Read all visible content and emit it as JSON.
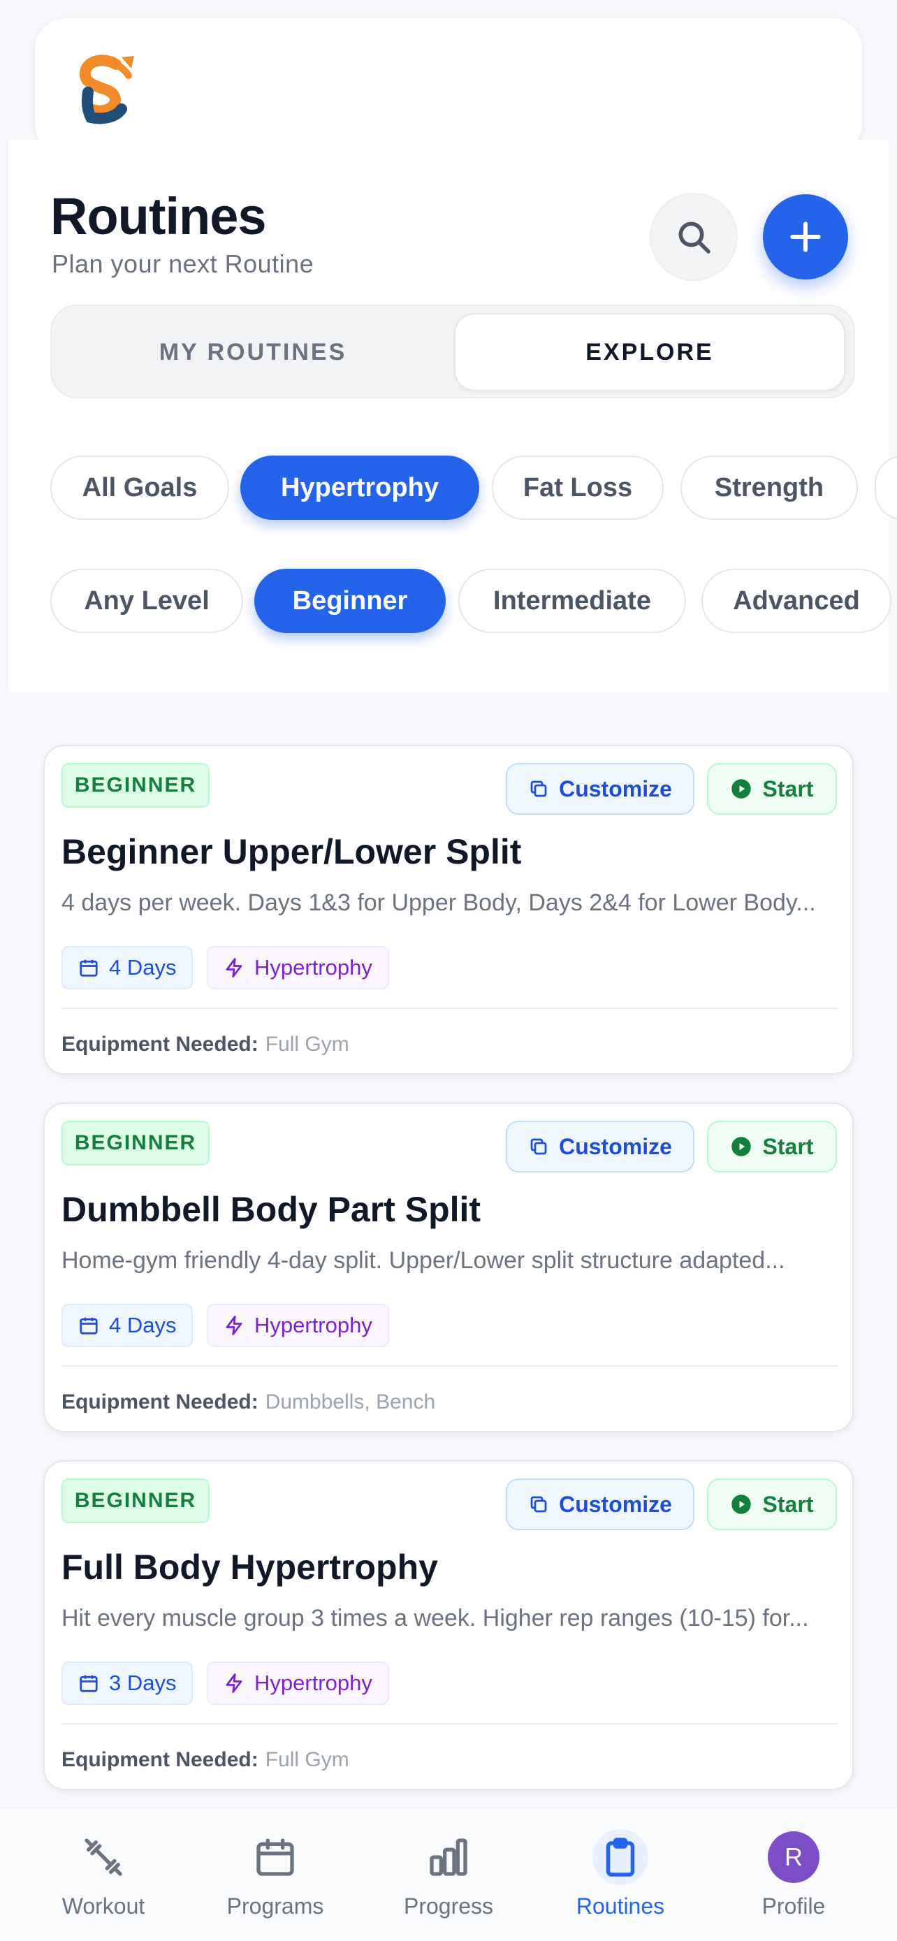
{
  "header": {
    "title": "Routines",
    "subtitle": "Plan your next Routine"
  },
  "segments": {
    "my_routines": "MY ROUTINES",
    "explore": "EXPLORE",
    "active": "explore"
  },
  "goal_filters": {
    "items": [
      "All Goals",
      "Hypertrophy",
      "Fat Loss",
      "Strength"
    ],
    "selected": "Hypertrophy"
  },
  "level_filters": {
    "items": [
      "Any Level",
      "Beginner",
      "Intermediate",
      "Advanced"
    ],
    "selected": "Beginner"
  },
  "card_actions": {
    "customize": "Customize",
    "start": "Start",
    "equipment_label": "Equipment Needed:"
  },
  "routines": [
    {
      "level": "BEGINNER",
      "title": "Beginner Upper/Lower Split",
      "description": "4 days per week. Days 1&3 for Upper Body, Days 2&4 for Lower Body...",
      "days": "4 Days",
      "goal": "Hypertrophy",
      "equipment": "Full Gym"
    },
    {
      "level": "BEGINNER",
      "title": "Dumbbell Body Part Split",
      "description": "Home-gym friendly 4-day split. Upper/Lower split structure adapted...",
      "days": "4 Days",
      "goal": "Hypertrophy",
      "equipment": "Dumbbells, Bench"
    },
    {
      "level": "BEGINNER",
      "title": "Full Body Hypertrophy",
      "description": "Hit every muscle group 3 times a week. Higher rep ranges (10-15) for...",
      "days": "3 Days",
      "goal": "Hypertrophy",
      "equipment": "Full Gym"
    }
  ],
  "tabbar": {
    "items": [
      {
        "label": "Workout",
        "icon": "dumbbell-icon"
      },
      {
        "label": "Programs",
        "icon": "calendar-icon"
      },
      {
        "label": "Progress",
        "icon": "bar-chart-icon"
      },
      {
        "label": "Routines",
        "icon": "clipboard-icon"
      },
      {
        "label": "Profile",
        "icon": "avatar"
      }
    ],
    "active": "Routines",
    "avatar_initial": "R"
  },
  "colors": {
    "primary": "#2563eb",
    "background": "#f5f7fa",
    "beginner_badge": "#15803d",
    "goal_tag": "#7e22ce",
    "avatar": "#7c4dc4"
  }
}
